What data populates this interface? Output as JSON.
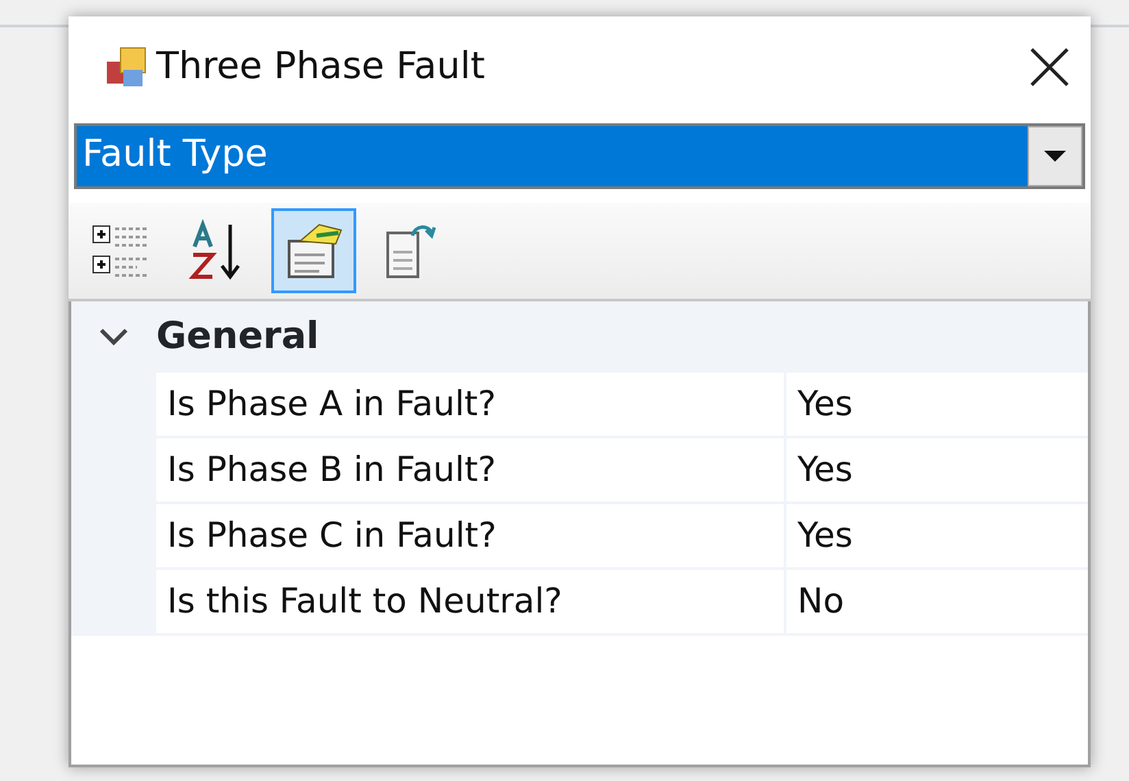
{
  "window": {
    "title": "Three Phase Fault"
  },
  "object_selector": {
    "value": "Fault Type"
  },
  "toolbar": [
    {
      "kind": "categorized",
      "selected": false
    },
    {
      "kind": "alphabetical",
      "selected": false
    },
    {
      "kind": "properties",
      "selected": true
    },
    {
      "kind": "pages",
      "selected": false
    }
  ],
  "category": {
    "label": "General",
    "expanded": true,
    "properties": [
      {
        "name": "Is Phase A in Fault?",
        "value": "Yes"
      },
      {
        "name": "Is Phase B in Fault?",
        "value": "Yes"
      },
      {
        "name": "Is Phase C in Fault?",
        "value": "Yes"
      },
      {
        "name": "Is this Fault to Neutral?",
        "value": "No"
      }
    ]
  }
}
